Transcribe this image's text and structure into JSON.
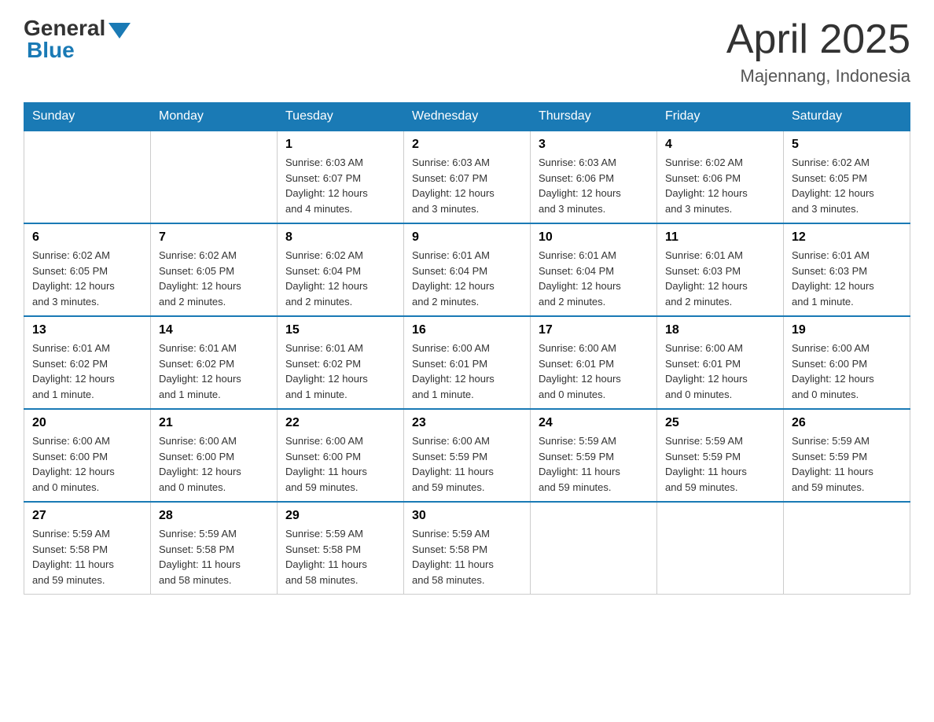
{
  "header": {
    "logo_general": "General",
    "logo_blue": "Blue",
    "month_title": "April 2025",
    "location": "Majennang, Indonesia"
  },
  "calendar": {
    "days_of_week": [
      "Sunday",
      "Monday",
      "Tuesday",
      "Wednesday",
      "Thursday",
      "Friday",
      "Saturday"
    ],
    "weeks": [
      [
        {
          "day": "",
          "info": ""
        },
        {
          "day": "",
          "info": ""
        },
        {
          "day": "1",
          "info": "Sunrise: 6:03 AM\nSunset: 6:07 PM\nDaylight: 12 hours\nand 4 minutes."
        },
        {
          "day": "2",
          "info": "Sunrise: 6:03 AM\nSunset: 6:07 PM\nDaylight: 12 hours\nand 3 minutes."
        },
        {
          "day": "3",
          "info": "Sunrise: 6:03 AM\nSunset: 6:06 PM\nDaylight: 12 hours\nand 3 minutes."
        },
        {
          "day": "4",
          "info": "Sunrise: 6:02 AM\nSunset: 6:06 PM\nDaylight: 12 hours\nand 3 minutes."
        },
        {
          "day": "5",
          "info": "Sunrise: 6:02 AM\nSunset: 6:05 PM\nDaylight: 12 hours\nand 3 minutes."
        }
      ],
      [
        {
          "day": "6",
          "info": "Sunrise: 6:02 AM\nSunset: 6:05 PM\nDaylight: 12 hours\nand 3 minutes."
        },
        {
          "day": "7",
          "info": "Sunrise: 6:02 AM\nSunset: 6:05 PM\nDaylight: 12 hours\nand 2 minutes."
        },
        {
          "day": "8",
          "info": "Sunrise: 6:02 AM\nSunset: 6:04 PM\nDaylight: 12 hours\nand 2 minutes."
        },
        {
          "day": "9",
          "info": "Sunrise: 6:01 AM\nSunset: 6:04 PM\nDaylight: 12 hours\nand 2 minutes."
        },
        {
          "day": "10",
          "info": "Sunrise: 6:01 AM\nSunset: 6:04 PM\nDaylight: 12 hours\nand 2 minutes."
        },
        {
          "day": "11",
          "info": "Sunrise: 6:01 AM\nSunset: 6:03 PM\nDaylight: 12 hours\nand 2 minutes."
        },
        {
          "day": "12",
          "info": "Sunrise: 6:01 AM\nSunset: 6:03 PM\nDaylight: 12 hours\nand 1 minute."
        }
      ],
      [
        {
          "day": "13",
          "info": "Sunrise: 6:01 AM\nSunset: 6:02 PM\nDaylight: 12 hours\nand 1 minute."
        },
        {
          "day": "14",
          "info": "Sunrise: 6:01 AM\nSunset: 6:02 PM\nDaylight: 12 hours\nand 1 minute."
        },
        {
          "day": "15",
          "info": "Sunrise: 6:01 AM\nSunset: 6:02 PM\nDaylight: 12 hours\nand 1 minute."
        },
        {
          "day": "16",
          "info": "Sunrise: 6:00 AM\nSunset: 6:01 PM\nDaylight: 12 hours\nand 1 minute."
        },
        {
          "day": "17",
          "info": "Sunrise: 6:00 AM\nSunset: 6:01 PM\nDaylight: 12 hours\nand 0 minutes."
        },
        {
          "day": "18",
          "info": "Sunrise: 6:00 AM\nSunset: 6:01 PM\nDaylight: 12 hours\nand 0 minutes."
        },
        {
          "day": "19",
          "info": "Sunrise: 6:00 AM\nSunset: 6:00 PM\nDaylight: 12 hours\nand 0 minutes."
        }
      ],
      [
        {
          "day": "20",
          "info": "Sunrise: 6:00 AM\nSunset: 6:00 PM\nDaylight: 12 hours\nand 0 minutes."
        },
        {
          "day": "21",
          "info": "Sunrise: 6:00 AM\nSunset: 6:00 PM\nDaylight: 12 hours\nand 0 minutes."
        },
        {
          "day": "22",
          "info": "Sunrise: 6:00 AM\nSunset: 6:00 PM\nDaylight: 11 hours\nand 59 minutes."
        },
        {
          "day": "23",
          "info": "Sunrise: 6:00 AM\nSunset: 5:59 PM\nDaylight: 11 hours\nand 59 minutes."
        },
        {
          "day": "24",
          "info": "Sunrise: 5:59 AM\nSunset: 5:59 PM\nDaylight: 11 hours\nand 59 minutes."
        },
        {
          "day": "25",
          "info": "Sunrise: 5:59 AM\nSunset: 5:59 PM\nDaylight: 11 hours\nand 59 minutes."
        },
        {
          "day": "26",
          "info": "Sunrise: 5:59 AM\nSunset: 5:59 PM\nDaylight: 11 hours\nand 59 minutes."
        }
      ],
      [
        {
          "day": "27",
          "info": "Sunrise: 5:59 AM\nSunset: 5:58 PM\nDaylight: 11 hours\nand 59 minutes."
        },
        {
          "day": "28",
          "info": "Sunrise: 5:59 AM\nSunset: 5:58 PM\nDaylight: 11 hours\nand 58 minutes."
        },
        {
          "day": "29",
          "info": "Sunrise: 5:59 AM\nSunset: 5:58 PM\nDaylight: 11 hours\nand 58 minutes."
        },
        {
          "day": "30",
          "info": "Sunrise: 5:59 AM\nSunset: 5:58 PM\nDaylight: 11 hours\nand 58 minutes."
        },
        {
          "day": "",
          "info": ""
        },
        {
          "day": "",
          "info": ""
        },
        {
          "day": "",
          "info": ""
        }
      ]
    ]
  }
}
